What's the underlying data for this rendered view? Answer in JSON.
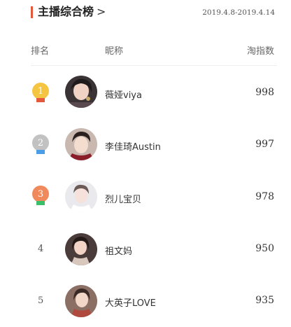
{
  "header": {
    "title": "主播综合榜",
    "arrow": ">",
    "date_range": "2019.4.8-2019.4.14",
    "accent_color": "#e4583e"
  },
  "columns": {
    "rank": "排名",
    "nickname": "昵称",
    "index": "淘指数"
  },
  "rows": [
    {
      "rank": "1",
      "nickname": "薇娅viya",
      "score": "998",
      "medal": true,
      "medal_color": "#f5c542",
      "ribbon_color": "#e4583e"
    },
    {
      "rank": "2",
      "nickname": "李佳琦Austin",
      "score": "997",
      "medal": true,
      "medal_color": "#c2c2c2",
      "ribbon_color": "#4a9ee8"
    },
    {
      "rank": "3",
      "nickname": "烈儿宝贝",
      "score": "978",
      "medal": true,
      "medal_color": "#f08a5d",
      "ribbon_color": "#3cbf6a"
    },
    {
      "rank": "4",
      "nickname": "祖文妈",
      "score": "950",
      "medal": false
    },
    {
      "rank": "5",
      "nickname": "大英子LOVE",
      "score": "935",
      "medal": false
    }
  ]
}
